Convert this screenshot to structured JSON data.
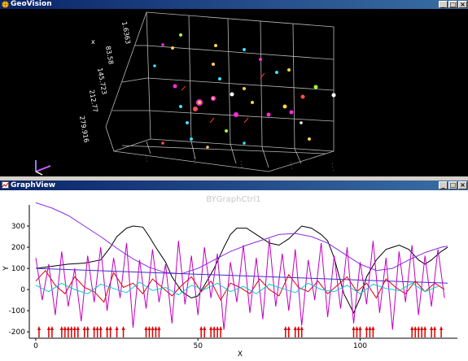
{
  "geo_window": {
    "title": "GeoVision",
    "buttons": [
      "_",
      "□",
      "×"
    ],
    "axis_labels": [
      "1.6363",
      "83.58",
      "145.723",
      "212.77",
      "279.916"
    ],
    "axis_letter": "x",
    "accent_color": "#ff2bd6"
  },
  "graph_window": {
    "title": "GraphView",
    "control_name": "BYGraphCtrl1",
    "buttons": [
      "_",
      "□",
      "×"
    ]
  },
  "chart_data": {
    "type": "line",
    "xlabel": "X",
    "ylabel": "Y",
    "xlim": [
      -2,
      130
    ],
    "ylim": [
      -230,
      400
    ],
    "xticks": [
      0,
      50,
      100
    ],
    "yticks": [
      -200,
      -100,
      0,
      100,
      200,
      300
    ],
    "grid": false,
    "series": [
      {
        "color": "#000000",
        "x": [
          0,
          5,
          10,
          15,
          20,
          23,
          25,
          28,
          30,
          33,
          35,
          37,
          40,
          42,
          45,
          48,
          50,
          52,
          55,
          58,
          60,
          62,
          65,
          68,
          70,
          72,
          75,
          78,
          80,
          82,
          85,
          88,
          90,
          92,
          95,
          98,
          100,
          102,
          105,
          108,
          110,
          112,
          115,
          118,
          120,
          122,
          125,
          127
        ],
        "y": [
          100,
          110,
          120,
          125,
          140,
          200,
          250,
          290,
          300,
          295,
          250,
          200,
          130,
          60,
          -10,
          -40,
          -30,
          20,
          100,
          200,
          260,
          290,
          290,
          260,
          240,
          220,
          210,
          240,
          270,
          300,
          290,
          260,
          230,
          150,
          -20,
          -110,
          -40,
          60,
          140,
          190,
          200,
          210,
          190,
          140,
          120,
          140,
          180,
          200
        ]
      },
      {
        "color": "#8a2be2",
        "x": [
          0,
          5,
          10,
          15,
          20,
          25,
          30,
          35,
          40,
          45,
          50,
          55,
          60,
          65,
          70,
          75,
          80,
          85,
          90,
          95,
          100,
          105,
          110,
          115,
          120,
          125,
          127
        ],
        "y": [
          410,
          385,
          350,
          300,
          250,
          195,
          145,
          105,
          80,
          75,
          100,
          140,
          180,
          210,
          235,
          260,
          265,
          250,
          220,
          170,
          120,
          90,
          100,
          140,
          175,
          200,
          205
        ]
      },
      {
        "color": "#3030d0",
        "x": [
          0,
          127
        ],
        "y": [
          100,
          30
        ]
      },
      {
        "color": "#e00000",
        "x": [
          0,
          3,
          6,
          9,
          12,
          15,
          18,
          21,
          24,
          27,
          30,
          33,
          36,
          39,
          42,
          45,
          48,
          51,
          54,
          57,
          60,
          63,
          66,
          69,
          72,
          75,
          78,
          81,
          84,
          87,
          90,
          93,
          96,
          99,
          102,
          105,
          108,
          111,
          114,
          117,
          120,
          123,
          126
        ],
        "y": [
          40,
          90,
          20,
          -20,
          60,
          10,
          -10,
          -60,
          80,
          10,
          30,
          -20,
          50,
          10,
          -30,
          20,
          60,
          -10,
          40,
          -50,
          30,
          10,
          -20,
          50,
          0,
          -30,
          70,
          10,
          -10,
          40,
          -20,
          20,
          60,
          -10,
          30,
          -40,
          50,
          10,
          -20,
          40,
          -10,
          30,
          0
        ]
      },
      {
        "color": "#c000c0",
        "x": [
          0,
          2,
          4,
          6,
          8,
          10,
          12,
          14,
          16,
          18,
          20,
          22,
          24,
          26,
          28,
          30,
          32,
          34,
          36,
          38,
          40,
          42,
          44,
          46,
          48,
          50,
          52,
          54,
          56,
          58,
          60,
          62,
          64,
          66,
          68,
          70,
          72,
          74,
          76,
          78,
          80,
          82,
          84,
          86,
          88,
          90,
          92,
          94,
          96,
          98,
          100,
          102,
          104,
          106,
          108,
          110,
          112,
          114,
          116,
          118,
          120,
          122,
          124,
          126
        ],
        "y": [
          150,
          -50,
          120,
          -120,
          180,
          -80,
          100,
          -150,
          160,
          -60,
          200,
          -100,
          150,
          -40,
          220,
          -180,
          140,
          -90,
          190,
          -60,
          120,
          -160,
          230,
          -70,
          160,
          -120,
          200,
          -40,
          170,
          -190,
          130,
          -60,
          210,
          -110,
          150,
          -140,
          240,
          -80,
          170,
          -100,
          190,
          -170,
          140,
          -50,
          220,
          -130,
          160,
          -90,
          200,
          -160,
          130,
          -70,
          230,
          -110,
          150,
          -190,
          180,
          -60,
          210,
          -120,
          160,
          -80,
          190,
          -40
        ]
      },
      {
        "color": "#00d0d0",
        "x": [
          0,
          4,
          8,
          12,
          16,
          20,
          24,
          28,
          32,
          36,
          40,
          44,
          48,
          52,
          56,
          60,
          64,
          68,
          72,
          76,
          80,
          84,
          88,
          92,
          96,
          100,
          104,
          108,
          112,
          116,
          120,
          124
        ],
        "y": [
          20,
          -10,
          30,
          0,
          -20,
          25,
          5,
          -15,
          35,
          -5,
          10,
          -25,
          20,
          0,
          30,
          -10,
          15,
          -20,
          25,
          5,
          -15,
          30,
          0,
          -10,
          20,
          -20,
          25,
          5,
          -5,
          30,
          -10,
          15
        ]
      }
    ],
    "markers": {
      "color": "#e00000",
      "x": [
        1,
        4,
        5,
        8,
        9,
        10,
        11,
        12,
        13,
        15,
        16,
        18,
        19,
        20,
        22,
        23,
        25,
        27,
        34,
        35,
        36,
        37,
        38,
        51,
        52,
        54,
        55,
        56,
        57,
        77,
        78,
        80,
        81,
        82,
        98,
        99,
        100,
        102,
        103,
        104,
        116,
        117,
        118,
        119,
        120,
        122,
        123,
        125
      ]
    }
  }
}
